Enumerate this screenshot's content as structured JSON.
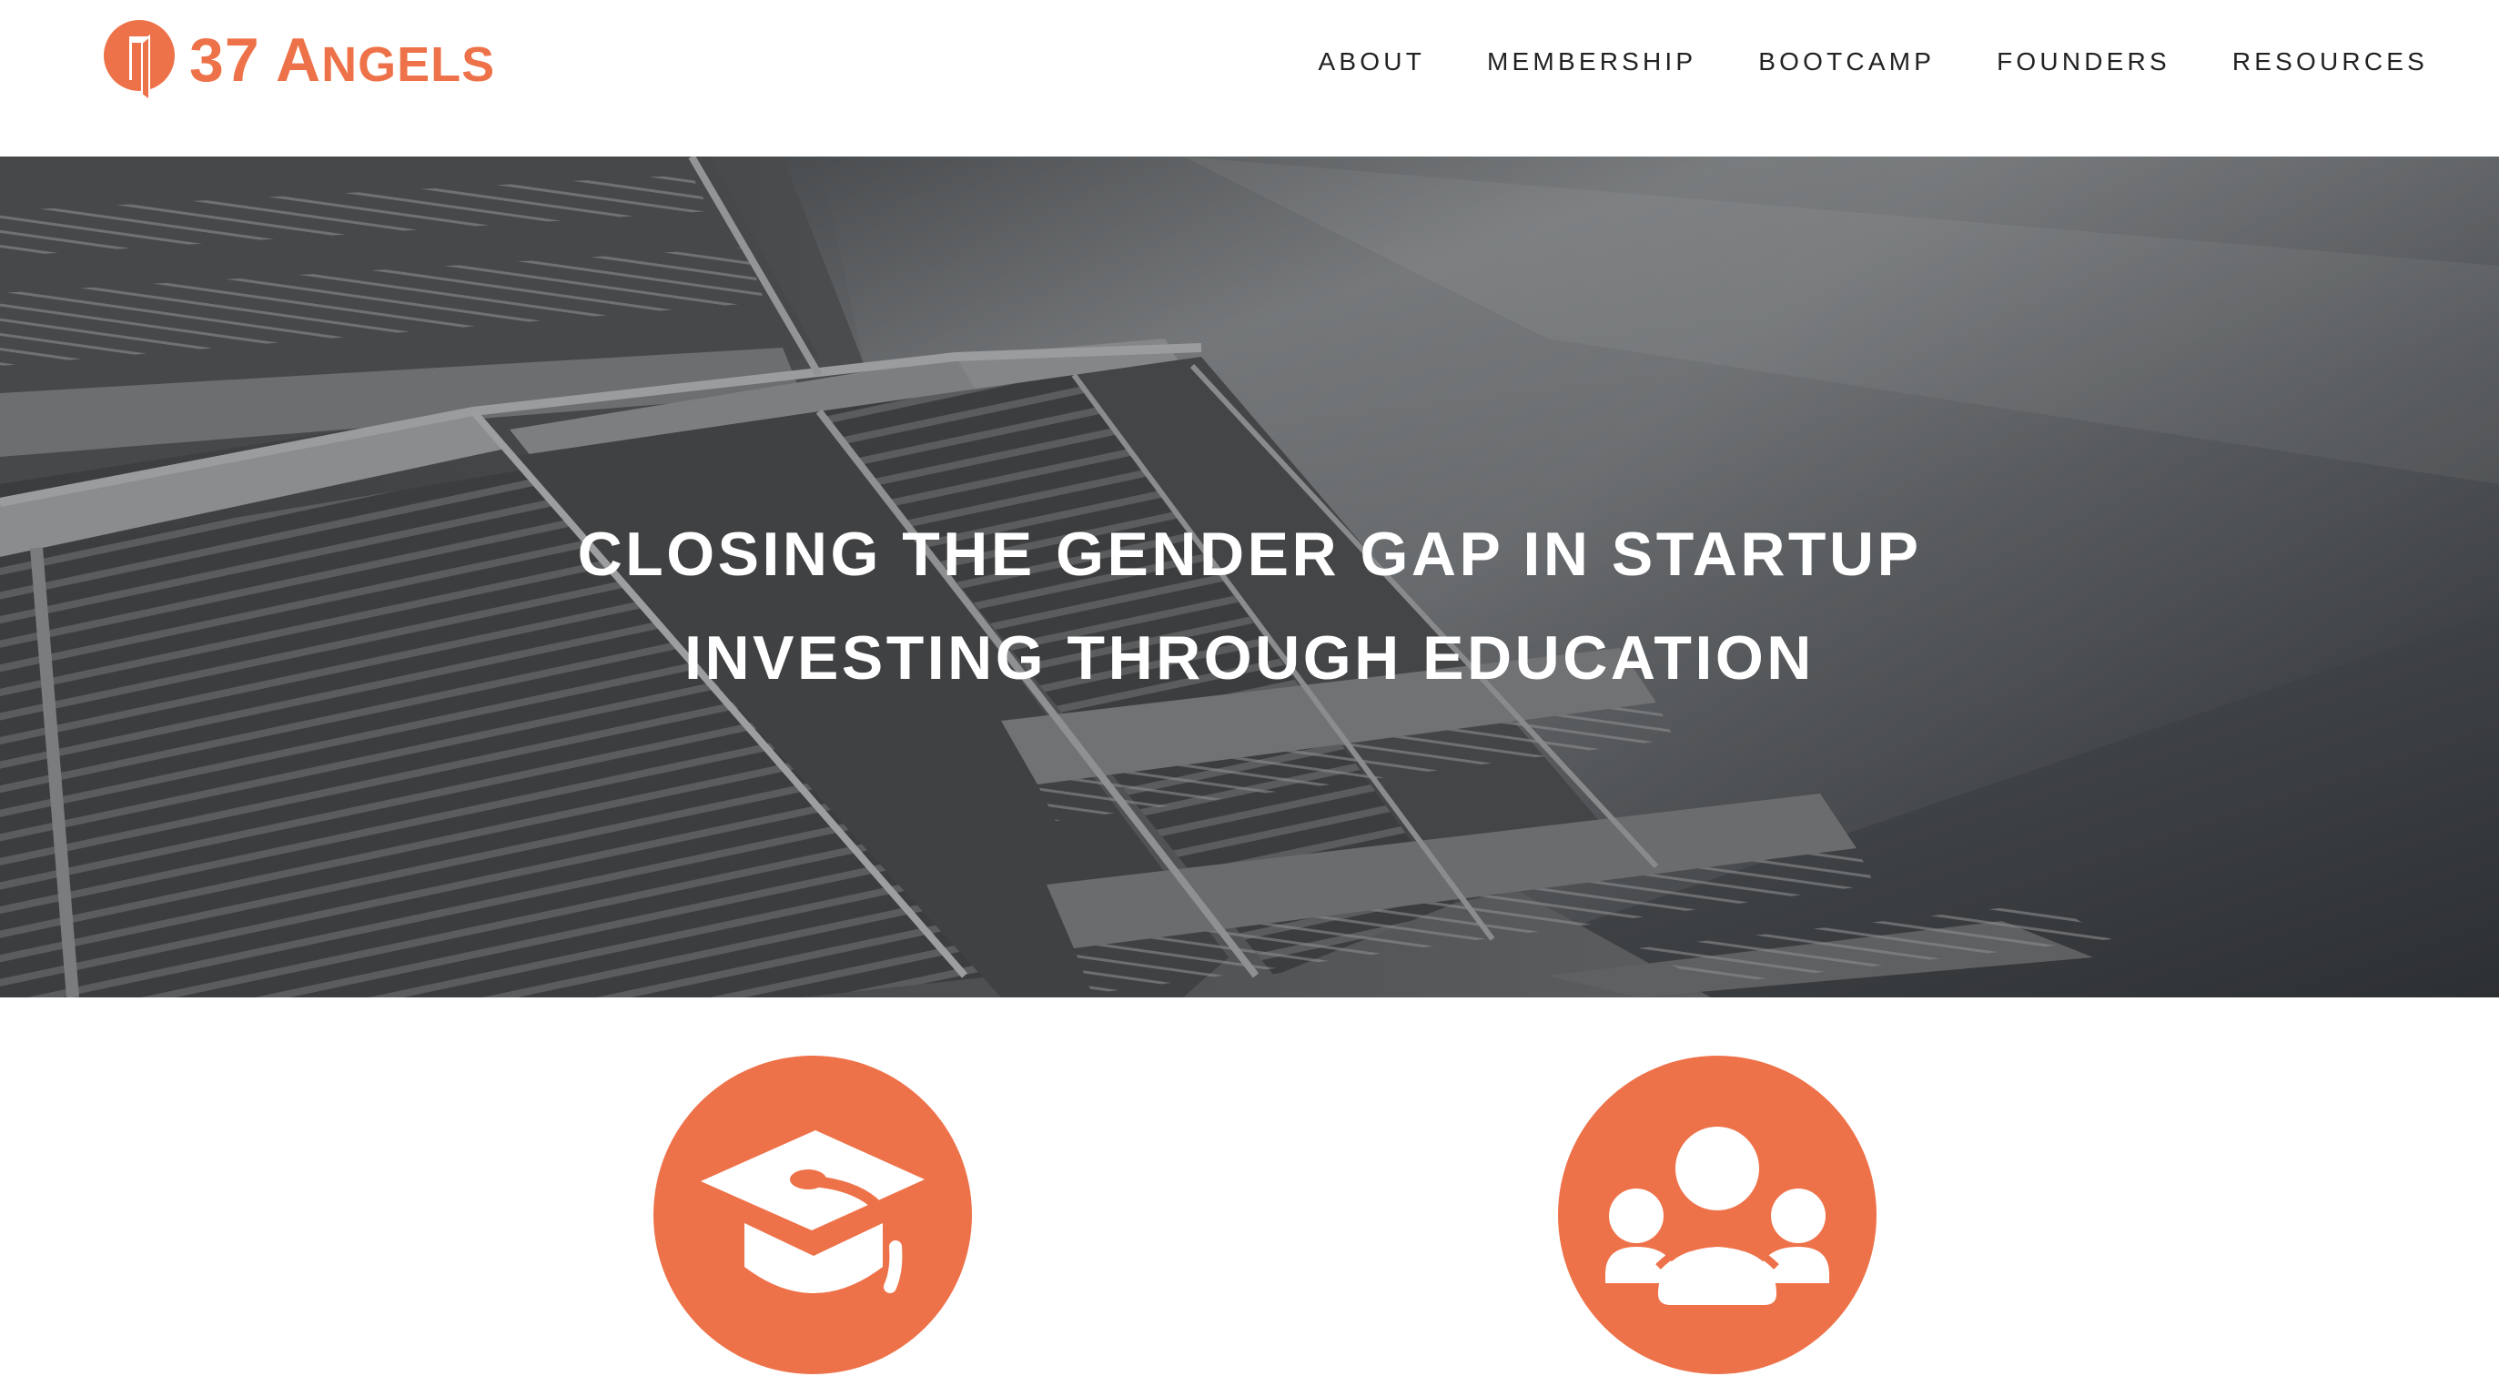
{
  "brand": {
    "name_part1": "37 A",
    "name_part2": "NGELS",
    "color": "#ee7249"
  },
  "nav": {
    "items": [
      {
        "label": "ABOUT"
      },
      {
        "label": "MEMBERSHIP"
      },
      {
        "label": "BOOTCAMP"
      },
      {
        "label": "FOUNDERS"
      },
      {
        "label": "RESOURCES"
      }
    ]
  },
  "hero": {
    "line1": "CLOSING THE GENDER GAP IN STARTUP",
    "line2": "INVESTING THROUGH EDUCATION"
  },
  "features": [
    {
      "icon": "graduation-cap-icon"
    },
    {
      "icon": "community-group-icon"
    }
  ]
}
